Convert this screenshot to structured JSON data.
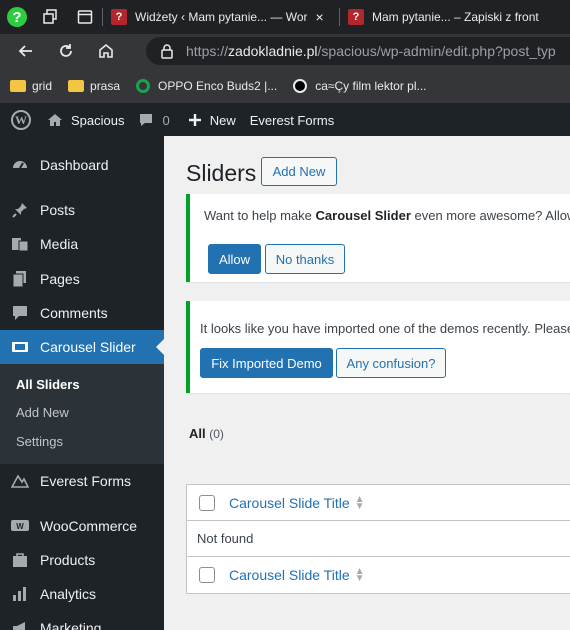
{
  "browser": {
    "tabs": [
      {
        "title": "Widżety ‹ Mam pytanie... — Wor",
        "close": "×"
      },
      {
        "title": "Mam pytanie... – Zapiski z front"
      }
    ],
    "url_prefix": "https://",
    "url_host": "zadokladnie.pl",
    "url_rest": "/spacious/wp-admin/edit.php?post_typ",
    "bookmarks": [
      {
        "label": "grid",
        "icon": "folder-icon"
      },
      {
        "label": "prasa",
        "icon": "folder-icon"
      },
      {
        "label": "OPPO Enco Buds2 |...",
        "icon": "oppo-icon"
      },
      {
        "label": "ca≈Çy film lektor pl...",
        "icon": "disc-icon"
      }
    ]
  },
  "adminbar": {
    "site_name": "Spacious",
    "comments_count": "0",
    "new_label": "New",
    "everest_label": "Everest Forms"
  },
  "sidebar": {
    "items": [
      {
        "label": "Dashboard",
        "icon": "dashboard-icon"
      },
      {
        "label": "Posts",
        "icon": "pin-icon"
      },
      {
        "label": "Media",
        "icon": "media-icon"
      },
      {
        "label": "Pages",
        "icon": "pages-icon"
      },
      {
        "label": "Comments",
        "icon": "comments-icon"
      },
      {
        "label": "Carousel Slider",
        "icon": "slider-icon"
      },
      {
        "label": "Everest Forms",
        "icon": "everest-icon"
      },
      {
        "label": "WooCommerce",
        "icon": "woo-icon"
      },
      {
        "label": "Products",
        "icon": "products-icon"
      },
      {
        "label": "Analytics",
        "icon": "analytics-icon"
      },
      {
        "label": "Marketing",
        "icon": "megaphone-icon"
      }
    ],
    "submenu": [
      {
        "label": "All Sliders"
      },
      {
        "label": "Add New"
      },
      {
        "label": "Settings"
      }
    ]
  },
  "main": {
    "title": "Sliders",
    "add_new": "Add New",
    "notice1": {
      "text_before": "Want to help make ",
      "bold": "Carousel Slider",
      "text_after": " even more awesome? Allow",
      "allow": "Allow",
      "no_thanks": "No thanks"
    },
    "notice2": {
      "text": "It looks like you have imported one of the demos recently. Please",
      "fix": "Fix Imported Demo",
      "confusion": "Any confusion?"
    },
    "views": {
      "all": "All",
      "count": "(0)"
    },
    "table": {
      "header": "Carousel Slide Title",
      "empty": "Not found",
      "footer": "Carousel Slide Title"
    }
  },
  "colors": {
    "accent": "#2271b1",
    "notice_border": "#00a32a",
    "admin_dark": "#1d2327"
  }
}
